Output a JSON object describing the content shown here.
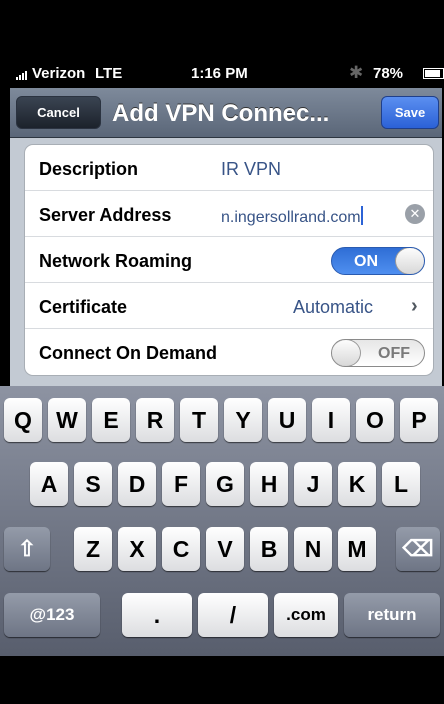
{
  "status_bar": {
    "carrier": "Verizon",
    "network": "LTE",
    "time": "1:16 PM",
    "battery": "78%"
  },
  "nav": {
    "cancel_label": "Cancel",
    "title": "Add VPN Connec...",
    "save_label": "Save"
  },
  "settings": {
    "description": {
      "label": "Description",
      "value": "IR VPN"
    },
    "server": {
      "label": "Server Address",
      "value": "n.ingersollrand.com"
    },
    "network_roaming": {
      "label": "Network Roaming",
      "state": "ON"
    },
    "certificate": {
      "label": "Certificate",
      "value": "Automatic"
    },
    "connect_on_demand": {
      "label": "Connect On Demand",
      "state": "OFF"
    }
  },
  "keyboard": {
    "row1": [
      "Q",
      "W",
      "E",
      "R",
      "T",
      "Y",
      "U",
      "I",
      "O",
      "P"
    ],
    "row2": [
      "A",
      "S",
      "D",
      "F",
      "G",
      "H",
      "J",
      "K",
      "L"
    ],
    "row3": [
      "Z",
      "X",
      "C",
      "V",
      "B",
      "N",
      "M"
    ],
    "numbers_label": "@123",
    "dot_label": ".",
    "slash_label": "/",
    "com_label": ".com",
    "return_label": "return"
  },
  "icons": {
    "shift": "shift-icon",
    "delete": "delete-icon",
    "bluetooth": "bluetooth-icon",
    "clear": "clear-text-icon"
  },
  "colors": {
    "accent_blue": "#2b61d6",
    "value_text": "#385487",
    "nav_bar": "#6a7688"
  }
}
